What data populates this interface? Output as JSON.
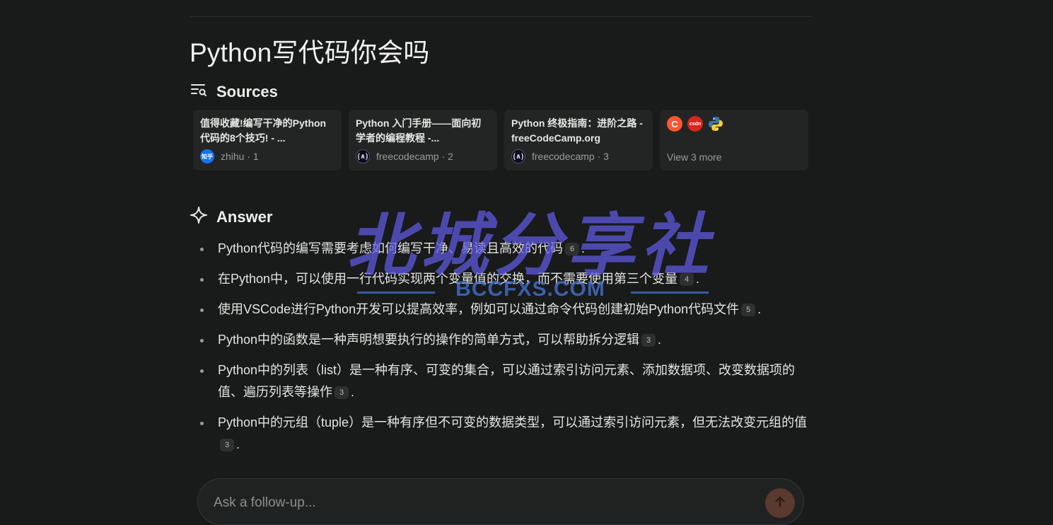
{
  "page": {
    "title": "Python写代码你会吗"
  },
  "sources": {
    "heading": "Sources",
    "cards": [
      {
        "title": "值得收藏!编写干净的Python 代码的8个技巧! - ...",
        "site": "zhihu · 1",
        "favicon_text": "知乎"
      },
      {
        "title": "Python 入门手册——面向初学者的编程教程 -...",
        "site": "freecodecamp · 2",
        "favicon_text": "(∧)"
      },
      {
        "title": "Python 终极指南：进阶之路 - freeCodeCamp.org",
        "site": "freecodecamp · 3",
        "favicon_text": "(∧)"
      }
    ],
    "more": {
      "label": "View 3 more",
      "icons": [
        "C",
        "csdn",
        "python-icon"
      ]
    }
  },
  "answer": {
    "heading": "Answer",
    "items": [
      {
        "text": "Python代码的编写需要考虑如何编写干净、易读且高效的代码",
        "cite": "6",
        "end": "."
      },
      {
        "text": "在Python中，可以使用一行代码实现两个变量值的交换，而不需要使用第三个变量",
        "cite": "4",
        "end": "."
      },
      {
        "text": "使用VSCode进行Python开发可以提高效率，例如可以通过命令代码创建初始Python代码文件",
        "cite": "5",
        "end": "."
      },
      {
        "text": "Python中的函数是一种声明想要执行的操作的简单方式，可以帮助拆分逻辑",
        "cite": "3",
        "end": "."
      },
      {
        "text": "Python中的列表（list）是一种有序、可变的集合，可以通过索引访问元素、添加数据项、改变数据项的值、遍历列表等操作",
        "cite": "3",
        "end": "."
      },
      {
        "text": "Python中的元组（tuple）是一种有序但不可变的数据类型，可以通过索引访问元素，但无法改变元组的值",
        "cite": "3",
        "end": "."
      }
    ]
  },
  "watermark": {
    "main": "北城分享社",
    "sub": "BCCFXS.COM"
  },
  "followup": {
    "placeholder": "Ask a follow-up..."
  },
  "colors": {
    "background": "#191a1a",
    "card": "#232525",
    "accent_send": "#5a3a2e",
    "watermark": "#5f5ce6"
  }
}
